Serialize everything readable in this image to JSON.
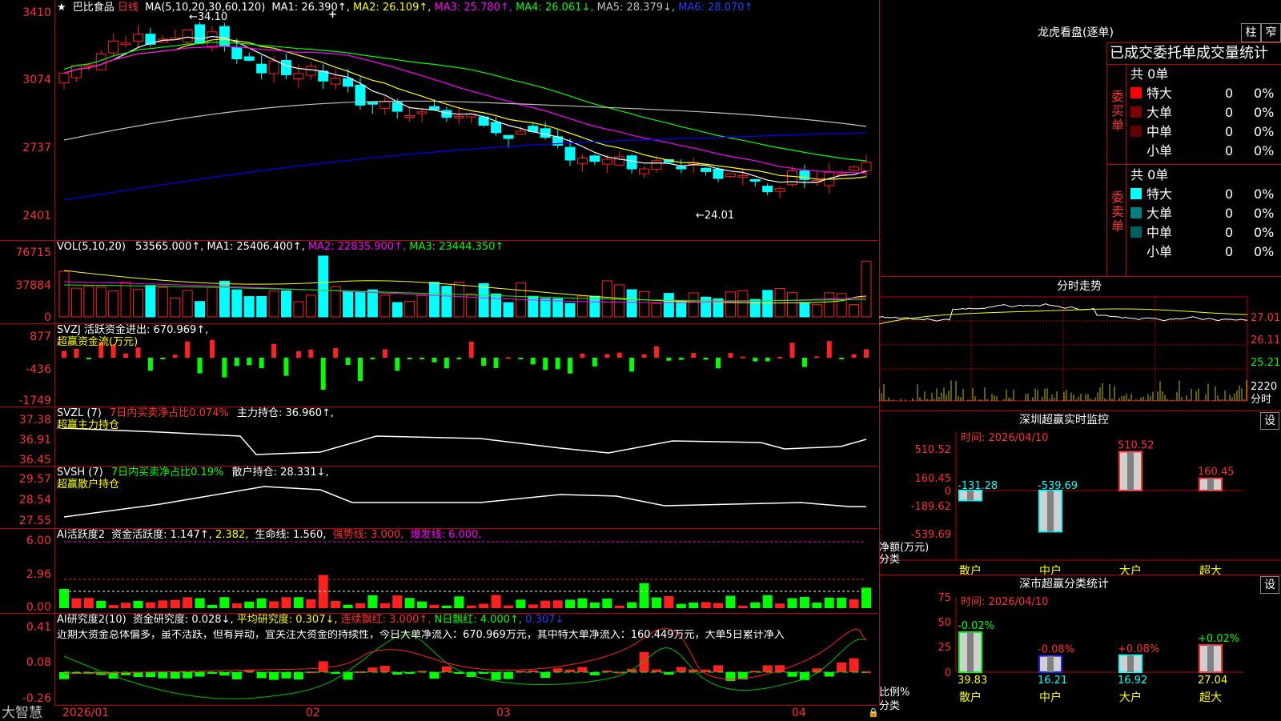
{
  "colors": {
    "up": "#ff2020",
    "down": "#00ffff",
    "frame": "#c00000",
    "ma1": "#ffffff",
    "ma2": "#ffff00",
    "ma3": "#ff00ff",
    "ma4": "#00ff00",
    "ma5": "#c0c0c0",
    "ma6": "#0000ff"
  },
  "price_panel": {
    "star": "★",
    "stock_name": "巴比食品",
    "period": "日线",
    "ma_label": "MA(5,10,20,30,60,120)",
    "ma1": "MA1: 26.390↑,",
    "ma2": "MA2: 26.109↑,",
    "ma3": "MA3: 25.780↑,",
    "ma4": "MA4: 26.061↓,",
    "ma5": "MA5: 28.379↓,",
    "ma6": "MA6: 28.070↑",
    "axis": [
      "3410",
      "3074",
      "2737",
      "2401"
    ],
    "high_label": "34.10",
    "low_label": "24.01",
    "cursor": "+"
  },
  "vol_panel": {
    "label": "VOL(5,10,20)",
    "vol": "53565.000↑,",
    "ma1": "MA1: 25406.400↑,",
    "ma2": "MA2: 22835.900↑,",
    "ma3": "MA3: 23444.350↑",
    "axis": [
      "76715",
      "37884",
      "0"
    ]
  },
  "svzj_panel": {
    "label": "SVZJ  活跃资金进出: 670.969↑,",
    "sub": "超赢资金流(万元)",
    "axis": [
      "877",
      "-436",
      "-1749"
    ]
  },
  "svzl_panel": {
    "label": "SVZL (7)",
    "pct": "7日内买卖净占比0.074%",
    "hold": "主力持仓: 36.960↑,",
    "sub": "超赢主力持仓",
    "axis": [
      "37.38",
      "36.91",
      "36.45"
    ]
  },
  "svsh_panel": {
    "label": "SVSH (7)",
    "pct": "7日内买卖净占比0.19%",
    "hold": "散户持仓: 28.331↓,",
    "sub": "超赢散户持仓",
    "axis": [
      "29.57",
      "28.54",
      "27.55"
    ]
  },
  "ai1_panel": {
    "label": "AI活跃度2",
    "act": "资金活跃度: 1.147↑,",
    "v2": "2.382,",
    "life": "生命线: 1.560,",
    "strong": "强势线: 3.000,",
    "burst": "爆发线: 6.000,",
    "axis": [
      "6.00",
      "2.96",
      "0.00"
    ]
  },
  "ai2_panel": {
    "label": "AI研究度2(10)",
    "res": "资金研究度: 0.028↓,",
    "avg": "平均研究度: 0.307↓,",
    "cont": "连续飘红: 3.000↑,",
    "nday": "N日飘红: 4.000↑,",
    "last": "0.307↓",
    "comment": "近期大资金总体偏多，虽不活跃，但有异动，宜关注大资金的持续性，今日大单净流入：670.969万元，其中特大单净流入：160.449万元，大单5日累计净入",
    "axis": [
      "0.41",
      "0.08",
      "-0.26"
    ]
  },
  "dates": [
    "2026/01",
    "02",
    "03",
    "04"
  ],
  "brand": "大智慧",
  "dragon": {
    "title": "龙虎看盘(逐单)",
    "btn1": "柱",
    "btn2": "窄",
    "header": "已成交委托单成交量统计",
    "buy": {
      "side": "委买单",
      "total": "共 0单",
      "rows": [
        {
          "name": "特大",
          "count": "0",
          "pct": "0%",
          "color": "#ff0000"
        },
        {
          "name": "大单",
          "count": "0",
          "pct": "0%",
          "color": "#800000"
        },
        {
          "name": "中单",
          "count": "0",
          "pct": "0%",
          "color": "#600000"
        },
        {
          "name": "小单",
          "count": "0",
          "pct": "0%",
          "color": ""
        }
      ]
    },
    "sell": {
      "side": "委卖单",
      "total": "共 0单",
      "rows": [
        {
          "name": "特大",
          "count": "0",
          "pct": "0%",
          "color": "#00ffff"
        },
        {
          "name": "大单",
          "count": "0",
          "pct": "0%",
          "color": "#008080"
        },
        {
          "name": "中单",
          "count": "0",
          "pct": "0%",
          "color": "#006060"
        },
        {
          "name": "小单",
          "count": "0",
          "pct": "0%",
          "color": ""
        }
      ]
    }
  },
  "intraday": {
    "title": "分时走势",
    "axis": [
      "27.01",
      "26.11",
      "25.21"
    ],
    "vol_label": "2220",
    "time_label": "分时"
  },
  "sz_monitor": {
    "title": "深圳超赢实时监控",
    "btn": "设",
    "time": "时间: 2026/04/10",
    "axis": [
      "510.52",
      "160.45",
      "0",
      "-189.62",
      "-539.69"
    ],
    "ylabel": "净额(万元)",
    "xlabel": "分类",
    "cats": [
      "散户",
      "中户",
      "大户",
      "超大"
    ],
    "values": [
      -131.28,
      -539.69,
      510.52,
      160.45
    ],
    "value_labels": [
      "-131.28",
      "-539.69",
      "510.52",
      "160.45"
    ]
  },
  "sz_class": {
    "title": "深市超赢分类统计",
    "btn": "设",
    "time": "时间: 2026/04/10",
    "axis": [
      "75",
      "50",
      "25",
      "0"
    ],
    "ylabel": "比例%",
    "xlabel": "分类",
    "cats": [
      "散户",
      "中户",
      "大户",
      "超大"
    ],
    "values": [
      39.83,
      16.21,
      16.92,
      27.04
    ],
    "value_labels": [
      "39.83",
      "16.21",
      "16.92",
      "27.04"
    ],
    "changes": [
      "-0.02%",
      "-0.08%",
      "+0.08%",
      "+0.02%"
    ]
  }
}
